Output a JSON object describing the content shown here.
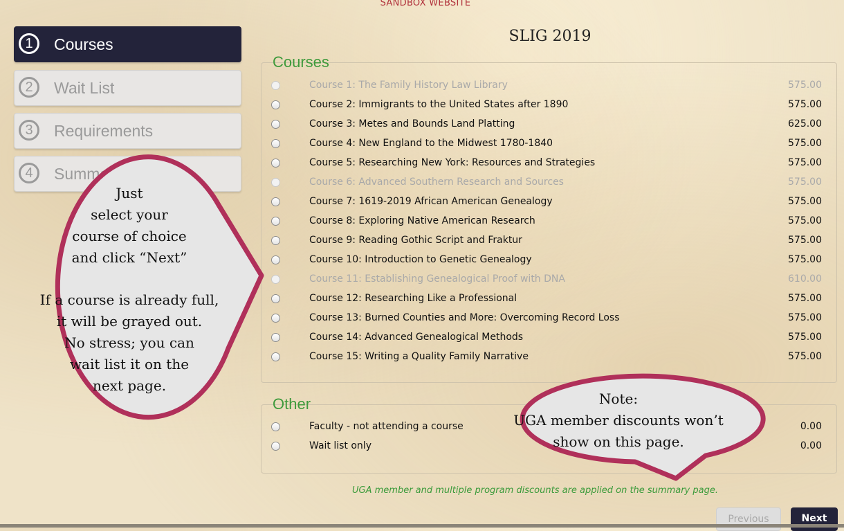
{
  "banner": "SANDBOX WEBSITE",
  "page_title": "SLIG 2019",
  "steps": [
    {
      "num": "1",
      "label": "Courses",
      "active": true
    },
    {
      "num": "2",
      "label": "Wait List",
      "active": false
    },
    {
      "num": "3",
      "label": "Requirements",
      "active": false
    },
    {
      "num": "4",
      "label": "Summary",
      "active": false
    }
  ],
  "courses": {
    "legend": "Courses",
    "items": [
      {
        "label": "Course 1: The Family History Law Library",
        "price": "575.00",
        "full": true
      },
      {
        "label": "Course 2: Immigrants to the United States after 1890",
        "price": "575.00",
        "full": false
      },
      {
        "label": "Course 3: Metes and Bounds Land Platting",
        "price": "625.00",
        "full": false
      },
      {
        "label": "Course 4: New England to the Midwest 1780-1840",
        "price": "575.00",
        "full": false
      },
      {
        "label": "Course 5: Researching New York: Resources and Strategies",
        "price": "575.00",
        "full": false
      },
      {
        "label": "Course 6: Advanced Southern Research and Sources",
        "price": "575.00",
        "full": true
      },
      {
        "label": "Course 7: 1619-2019 African American Genealogy",
        "price": "575.00",
        "full": false
      },
      {
        "label": "Course 8: Exploring Native American Research",
        "price": "575.00",
        "full": false
      },
      {
        "label": "Course 9: Reading Gothic Script and Fraktur",
        "price": "575.00",
        "full": false
      },
      {
        "label": "Course 10: Introduction to Genetic Genealogy",
        "price": "575.00",
        "full": false
      },
      {
        "label": "Course 11: Establishing Genealogical Proof with DNA",
        "price": "610.00",
        "full": true
      },
      {
        "label": "Course 12: Researching Like a Professional",
        "price": "575.00",
        "full": false
      },
      {
        "label": "Course 13: Burned Counties and More: Overcoming Record Loss",
        "price": "575.00",
        "full": false
      },
      {
        "label": "Course 14: Advanced Genealogical Methods",
        "price": "575.00",
        "full": false
      },
      {
        "label": "Course 15: Writing a Quality Family Narrative",
        "price": "575.00",
        "full": false
      }
    ]
  },
  "other": {
    "legend": "Other",
    "items": [
      {
        "label": "Faculty - not attending a course",
        "price": "0.00"
      },
      {
        "label": "Wait list only",
        "price": "0.00"
      }
    ]
  },
  "discount_note": "UGA member and multiple program discounts are applied on the summary page.",
  "buttons": {
    "previous": "Previous",
    "next": "Next"
  },
  "callout_left": {
    "lines1": [
      "Just",
      "select your",
      "course of choice",
      "and click “Next”"
    ],
    "lines2": [
      "If a course is already full,",
      "it will be grayed out.",
      "No stress; you can",
      "wait list it on the",
      "next page."
    ]
  },
  "callout_right": {
    "lines": [
      "Note:",
      "UGA member discounts won’t",
      "show on this page."
    ]
  },
  "colors": {
    "accent_dark": "#23233a",
    "legend_green": "#3f9a3c",
    "callout_border": "#b0305a",
    "banner_red": "#b0303a"
  }
}
